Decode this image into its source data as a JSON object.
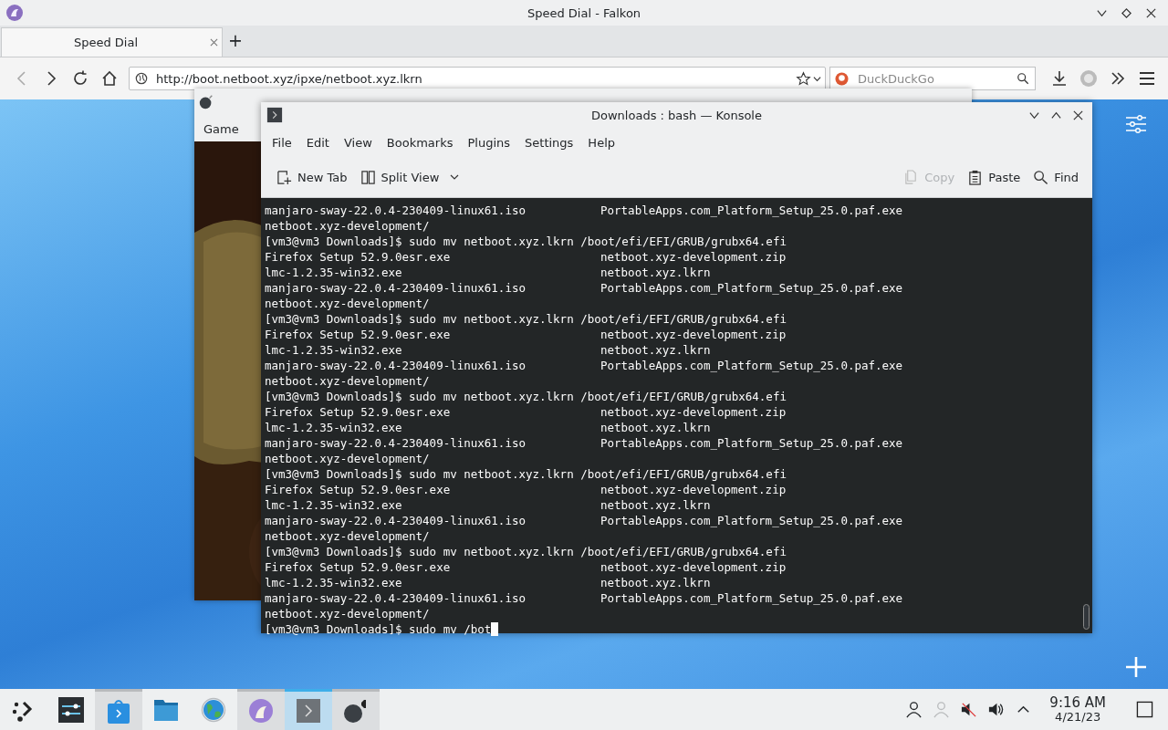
{
  "browser": {
    "title": "Speed Dial - Falkon",
    "tabs": [
      {
        "label": "Speed Dial",
        "selected": true
      }
    ],
    "new_tab": "+",
    "url": "http://boot.netboot.xyz/ipxe/netboot.xyz.lkrn",
    "search": {
      "placeholder": "DuckDuckGo"
    }
  },
  "game_window": {
    "menu": [
      "Game"
    ]
  },
  "terminal_window": {
    "title": "Downloads : bash — Konsole",
    "menu": [
      "File",
      "Edit",
      "View",
      "Bookmarks",
      "Plugins",
      "Settings",
      "Help"
    ],
    "toolbar": [
      {
        "kind": "new-tab",
        "label": "New Tab",
        "disabled": false
      },
      {
        "kind": "split",
        "label": "Split View",
        "disabled": false
      },
      {
        "kind": "copy",
        "label": "Copy",
        "disabled": true
      },
      {
        "kind": "paste",
        "label": "Paste",
        "disabled": false
      },
      {
        "kind": "find",
        "label": "Find",
        "disabled": false
      }
    ],
    "lines": [
      {
        "kind": "listing",
        "cells": [
          "manjaro-sway-22.0.4-230409-linux61.iso",
          "PortableApps.com_Platform_Setup_25.0.paf.exe"
        ]
      },
      {
        "kind": "listing",
        "cells": [
          "netboot.xyz-development/"
        ]
      },
      {
        "kind": "prompt",
        "text": "[vm3@vm3 Downloads]$ sudo mv netboot.xyz.lkrn /boot/efi/EFI/GRUB/grubx64.efi"
      },
      {
        "kind": "listing",
        "cells": [
          "Firefox Setup 52.9.0esr.exe",
          "netboot.xyz-development.zip"
        ]
      },
      {
        "kind": "listing",
        "cells": [
          "lmc-1.2.35-win32.exe",
          "netboot.xyz.lkrn"
        ]
      },
      {
        "kind": "listing",
        "cells": [
          "manjaro-sway-22.0.4-230409-linux61.iso",
          "PortableApps.com_Platform_Setup_25.0.paf.exe"
        ]
      },
      {
        "kind": "listing",
        "cells": [
          "netboot.xyz-development/"
        ]
      },
      {
        "kind": "prompt",
        "text": "[vm3@vm3 Downloads]$ sudo mv netboot.xyz.lkrn /boot/efi/EFI/GRUB/grubx64.efi"
      },
      {
        "kind": "listing",
        "cells": [
          "Firefox Setup 52.9.0esr.exe",
          "netboot.xyz-development.zip"
        ]
      },
      {
        "kind": "listing",
        "cells": [
          "lmc-1.2.35-win32.exe",
          "netboot.xyz.lkrn"
        ]
      },
      {
        "kind": "listing",
        "cells": [
          "manjaro-sway-22.0.4-230409-linux61.iso",
          "PortableApps.com_Platform_Setup_25.0.paf.exe"
        ]
      },
      {
        "kind": "listing",
        "cells": [
          "netboot.xyz-development/"
        ]
      },
      {
        "kind": "prompt",
        "text": "[vm3@vm3 Downloads]$ sudo mv netboot.xyz.lkrn /boot/efi/EFI/GRUB/grubx64.efi"
      },
      {
        "kind": "listing",
        "cells": [
          "Firefox Setup 52.9.0esr.exe",
          "netboot.xyz-development.zip"
        ]
      },
      {
        "kind": "listing",
        "cells": [
          "lmc-1.2.35-win32.exe",
          "netboot.xyz.lkrn"
        ]
      },
      {
        "kind": "listing",
        "cells": [
          "manjaro-sway-22.0.4-230409-linux61.iso",
          "PortableApps.com_Platform_Setup_25.0.paf.exe"
        ]
      },
      {
        "kind": "listing",
        "cells": [
          "netboot.xyz-development/"
        ]
      },
      {
        "kind": "prompt",
        "text": "[vm3@vm3 Downloads]$ sudo mv netboot.xyz.lkrn /boot/efi/EFI/GRUB/grubx64.efi"
      },
      {
        "kind": "listing",
        "cells": [
          "Firefox Setup 52.9.0esr.exe",
          "netboot.xyz-development.zip"
        ]
      },
      {
        "kind": "listing",
        "cells": [
          "lmc-1.2.35-win32.exe",
          "netboot.xyz.lkrn"
        ]
      },
      {
        "kind": "listing",
        "cells": [
          "manjaro-sway-22.0.4-230409-linux61.iso",
          "PortableApps.com_Platform_Setup_25.0.paf.exe"
        ]
      },
      {
        "kind": "listing",
        "cells": [
          "netboot.xyz-development/"
        ]
      },
      {
        "kind": "prompt",
        "text": "[vm3@vm3 Downloads]$ sudo mv netboot.xyz.lkrn /boot/efi/EFI/GRUB/grubx64.efi"
      },
      {
        "kind": "listing",
        "cells": [
          "Firefox Setup 52.9.0esr.exe",
          "netboot.xyz-development.zip"
        ]
      },
      {
        "kind": "listing",
        "cells": [
          "lmc-1.2.35-win32.exe",
          "netboot.xyz.lkrn"
        ]
      },
      {
        "kind": "listing",
        "cells": [
          "manjaro-sway-22.0.4-230409-linux61.iso",
          "PortableApps.com_Platform_Setup_25.0.paf.exe"
        ]
      },
      {
        "kind": "listing",
        "cells": [
          "netboot.xyz-development/"
        ]
      },
      {
        "kind": "prompt",
        "text": "[vm3@vm3 Downloads]$ sudo mv /bot",
        "cursor": true
      }
    ]
  },
  "taskbar": {
    "items": [
      {
        "kind": "launcher",
        "running": false,
        "active": false
      },
      {
        "kind": "settings",
        "running": false,
        "active": false
      },
      {
        "kind": "store",
        "running": true,
        "active": false
      },
      {
        "kind": "folder",
        "running": false,
        "active": false
      },
      {
        "kind": "globe",
        "running": false,
        "active": false
      },
      {
        "kind": "browser",
        "running": true,
        "active": false
      },
      {
        "kind": "terminal",
        "running": true,
        "active": true
      },
      {
        "kind": "game",
        "running": true,
        "active": false
      }
    ],
    "tray": [
      {
        "kind": "user",
        "disabled": false
      },
      {
        "kind": "user-switch",
        "disabled": true
      },
      {
        "kind": "muted",
        "disabled": false
      },
      {
        "kind": "volume",
        "disabled": false
      },
      {
        "kind": "expand",
        "disabled": false
      }
    ],
    "time": "9:16 AM",
    "date": "4/21/23"
  }
}
